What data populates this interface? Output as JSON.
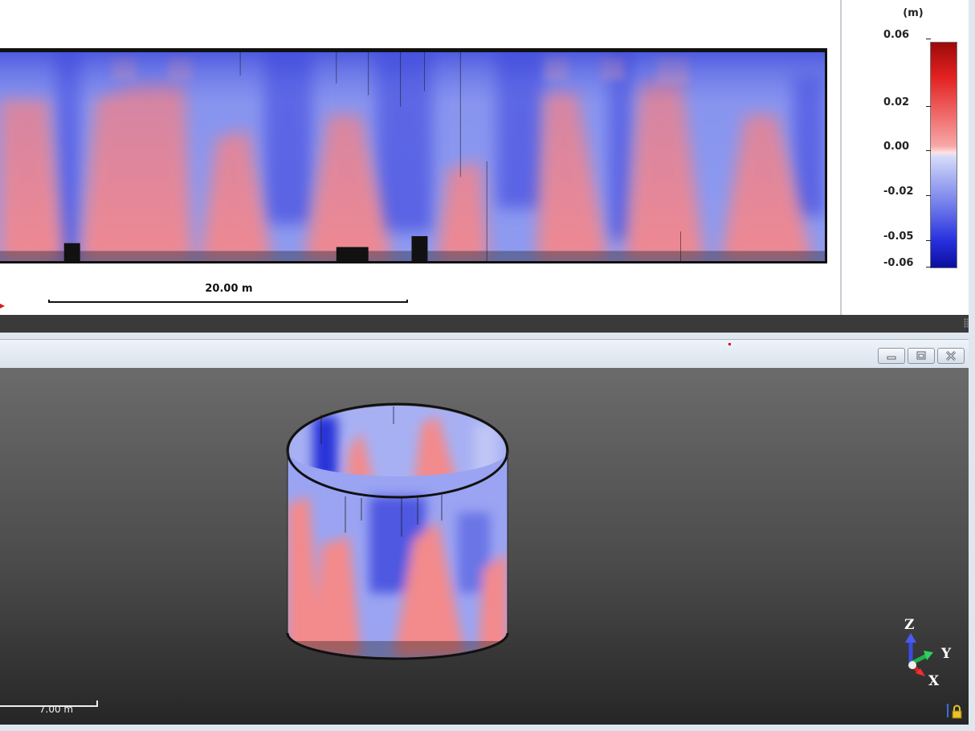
{
  "top_view": {
    "scale_label": "20.00 m"
  },
  "legend": {
    "unit": "(m)",
    "ticks": [
      "0.06",
      "0.02",
      "0.00",
      "-0.02",
      "-0.05",
      "-0.06"
    ],
    "color_max": "#9c0a0a",
    "color_zero": "#f2f2fb",
    "color_min": "#0b0f9e"
  },
  "view3d": {
    "scale_label": "7.00 m",
    "axes": {
      "z": "Z",
      "y": "Y",
      "x": "X"
    },
    "window_buttons": [
      "minimize-icon",
      "restore-icon",
      "close-icon"
    ],
    "background_top": "#6b6b6b",
    "background_bottom": "#262626"
  }
}
